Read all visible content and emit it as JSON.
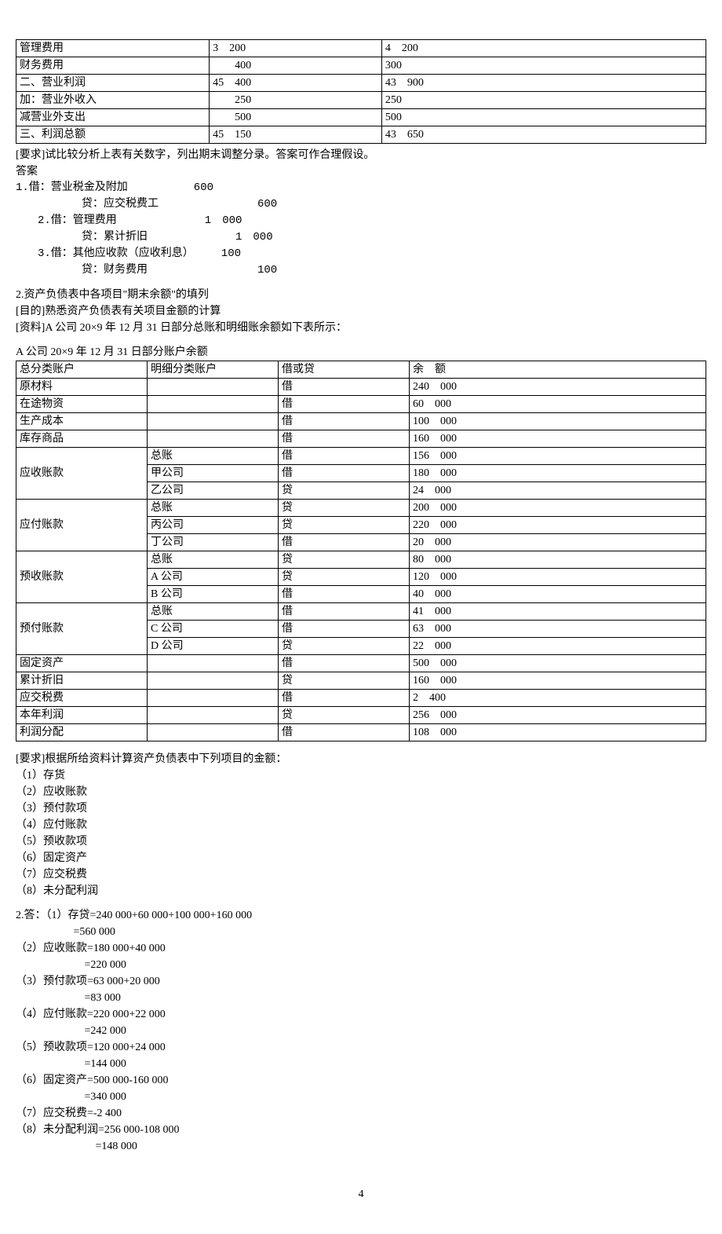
{
  "table1": {
    "rows": [
      {
        "c0": "管理费用",
        "c1": "3　200",
        "c2": "4　200"
      },
      {
        "c0": "财务费用",
        "c1": "　　400",
        "c2": "300"
      },
      {
        "c0": "二、营业利润",
        "c1": "45　400",
        "c2": "43　900"
      },
      {
        "c0": "加：营业外收入",
        "c1": "　　250",
        "c2": "250"
      },
      {
        "c0": "减营业外支出",
        "c1": "　　500",
        "c2": "500"
      },
      {
        "c0": "三、利润总额",
        "c1": "45　150",
        "c2": "43　650"
      }
    ]
  },
  "analysis": {
    "requirement": "[要求]试比较分析上表有关数字，列出期末调整分录。答案可作合理假设。",
    "answer_label": "答案",
    "entries": [
      "1.借：营业税金及附加　　　　　　600",
      "　　　　　　贷：应交税费工　　　　　　　　　600",
      "　　2.借：管理费用　　　　　　　　1　000",
      "　　　　　　贷：累计折旧　　　　　　　　1　000",
      "　　3.借：其他应收款（应收利息）　　　100",
      "　　　　　　贷：财务费用　　　　　　　　　　100"
    ]
  },
  "section2": {
    "title": "2.资产负债表中各项目\"期末余额\"的填列",
    "purpose": "[目的]熟悉资产负债表有关项目金额的计算",
    "material": "[资料]A 公司 20×9 年 12 月 31 日部分总账和明细账余额如下表所示：",
    "table_title": "A 公司 20×9 年 12 月 31 日部分账户余额"
  },
  "table2": {
    "headers": [
      "总分类账户",
      "明细分类账户",
      "借或贷",
      "余　额"
    ],
    "rows": [
      {
        "c0": "原材料",
        "c1": "",
        "c2": "借",
        "c3": "240　000"
      },
      {
        "c0": "在途物资",
        "c1": "",
        "c2": "借",
        "c3": "60　000"
      },
      {
        "c0": "生产成本",
        "c1": "",
        "c2": "借",
        "c3": "100　000"
      },
      {
        "c0": "库存商品",
        "c1": "",
        "c2": "借",
        "c3": "160　000"
      },
      {
        "c0": "",
        "c1": "总账",
        "c2": "借",
        "c3": "156　000",
        "rowspan_start": true,
        "rowspan": 3,
        "rowspan_label": "应收账款"
      },
      {
        "c0": "",
        "c1": "甲公司",
        "c2": "借",
        "c3": "180　000"
      },
      {
        "c0": "",
        "c1": "乙公司",
        "c2": "贷",
        "c3": "24　000"
      },
      {
        "c0": "",
        "c1": "总账",
        "c2": "贷",
        "c3": "200　000",
        "rowspan_start": true,
        "rowspan": 3,
        "rowspan_label": "应付账款"
      },
      {
        "c0": "",
        "c1": "丙公司",
        "c2": "贷",
        "c3": "220　000"
      },
      {
        "c0": "",
        "c1": "丁公司",
        "c2": "借",
        "c3": "20　000"
      },
      {
        "c0": "",
        "c1": "总账",
        "c2": "贷",
        "c3": "80　000",
        "rowspan_start": true,
        "rowspan": 3,
        "rowspan_label": "预收账款"
      },
      {
        "c0": "",
        "c1": "A 公司",
        "c2": "贷",
        "c3": "120　000"
      },
      {
        "c0": "",
        "c1": "B 公司",
        "c2": "借",
        "c3": "40　000"
      },
      {
        "c0": "",
        "c1": "总账",
        "c2": "借",
        "c3": "41　000",
        "rowspan_start": true,
        "rowspan": 3,
        "rowspan_label": "预付账款"
      },
      {
        "c0": "",
        "c1": "C 公司",
        "c2": "借",
        "c3": "63　000"
      },
      {
        "c0": "",
        "c1": "D 公司",
        "c2": "贷",
        "c3": "22　000"
      },
      {
        "c0": "固定资产",
        "c1": "",
        "c2": "借",
        "c3": "500　000"
      },
      {
        "c0": "累计折旧",
        "c1": "",
        "c2": "贷",
        "c3": "160　000"
      },
      {
        "c0": "应交税费",
        "c1": "",
        "c2": "借",
        "c3": "2　400"
      },
      {
        "c0": "本年利润",
        "c1": "",
        "c2": "贷",
        "c3": "256　000"
      },
      {
        "c0": "利润分配",
        "c1": "",
        "c2": "借",
        "c3": "108　000"
      }
    ]
  },
  "requirements2": {
    "intro": "[要求]根据所给资料计算资产负债表中下列项目的金额：",
    "items": [
      "（1）存货",
      "（2）应收账款",
      "（3）预付款项",
      "（4）应付账款",
      "（5）预收款项",
      "（6）固定资产",
      "（7）应交税费",
      "（8）未分配利润"
    ]
  },
  "answers2": {
    "lines": [
      "2.答：（1）存贷=240 000+60 000+100 000+160 000",
      "　　　　　 =560 000",
      "（2）应收账款=180 000+40 000",
      "　　　　　　 =220 000",
      "（3）预付款项=63 000+20 000",
      "　　　　　　 =83 000",
      "（4）应付账款=220 000+22 000",
      "　　　　　　 =242 000",
      "（5）预收款项=120 000+24 000",
      "　　　　　　 =144 000",
      "（6）固定资产=500 000-160 000",
      "　　　　　　 =340 000",
      "（7）应交税费=-2 400",
      "（8）未分配利润=256 000-108 000",
      "　　　　　　　 =148 000"
    ]
  },
  "pagenum": "4"
}
